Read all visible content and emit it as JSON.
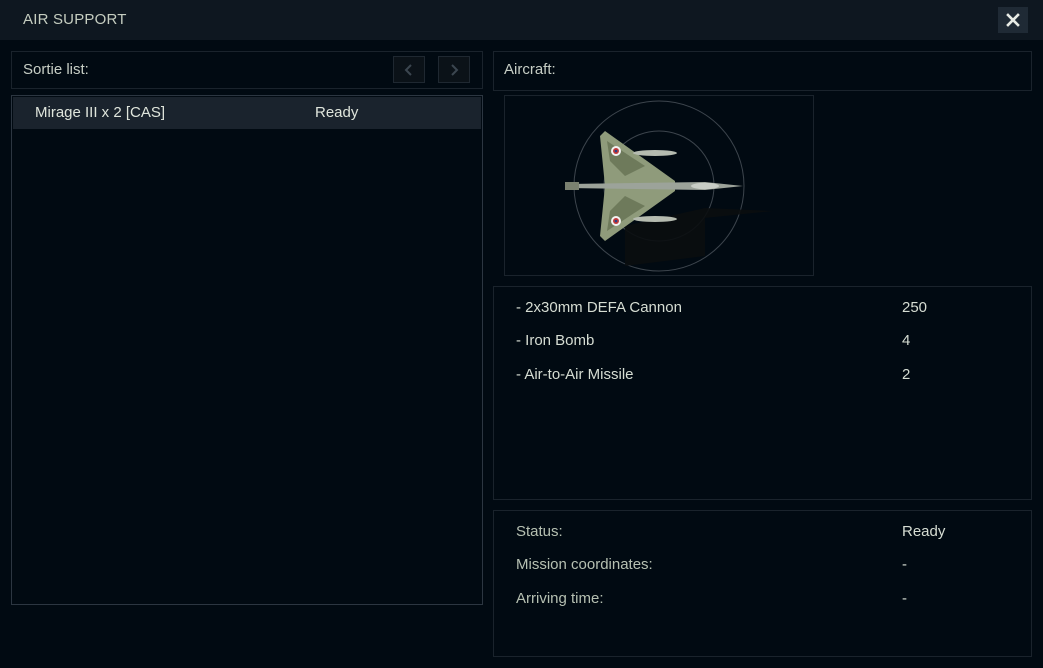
{
  "window": {
    "title": "AIR SUPPORT"
  },
  "sortie": {
    "label": "Sortie list:",
    "items": [
      {
        "name": "Mirage III x 2 [CAS]",
        "status": "Ready"
      }
    ]
  },
  "aircraft": {
    "label": "Aircraft:"
  },
  "weapons": [
    {
      "name": "- 2x30mm DEFA Cannon",
      "count": "250"
    },
    {
      "name": "- Iron Bomb",
      "count": "4"
    },
    {
      "name": "- Air-to-Air Missile",
      "count": "2"
    }
  ],
  "status": [
    {
      "label": "Status:",
      "value": "Ready"
    },
    {
      "label": "Mission coordinates:",
      "value": "-"
    },
    {
      "label": "Arriving time:",
      "value": "-"
    }
  ],
  "icons": {
    "close": "close-icon",
    "prev": "chevron-left-icon",
    "next": "chevron-right-icon"
  },
  "colors": {
    "background": "#010a12",
    "titlebar": "#0e1720",
    "selected_row": "#1a232d",
    "text": "#c7cec5"
  }
}
